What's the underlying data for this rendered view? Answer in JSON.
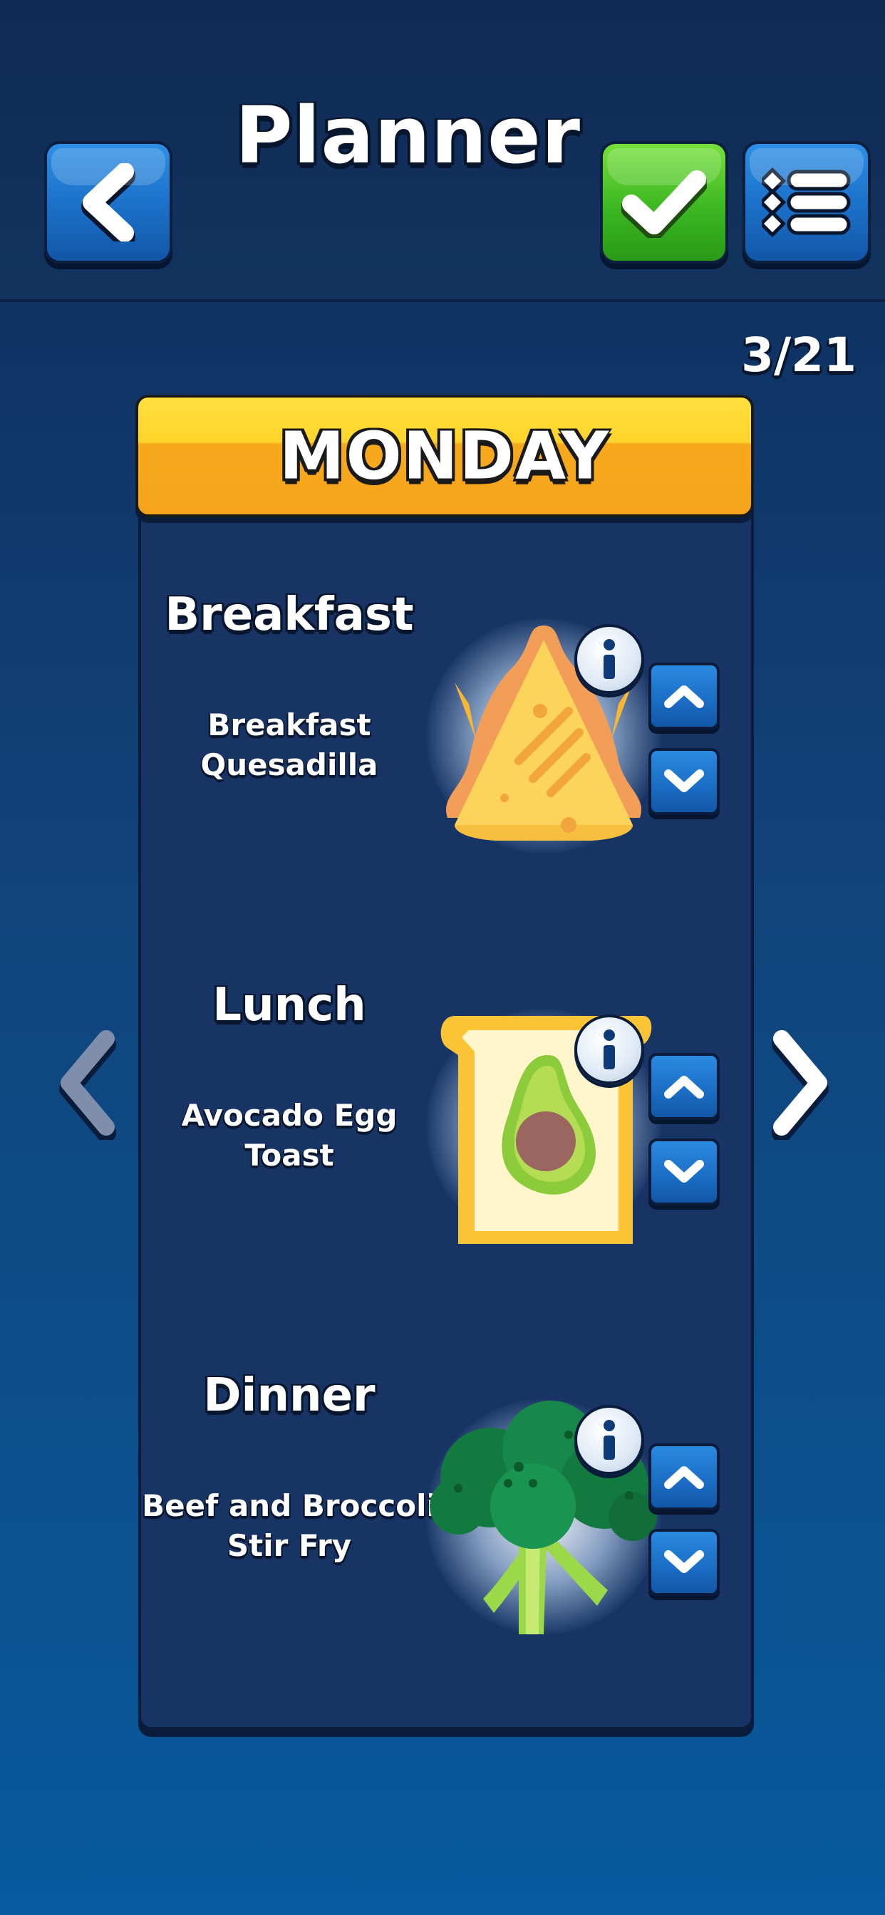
{
  "header": {
    "title": "Planner",
    "back_icon": "chevron-left-icon",
    "confirm_icon": "checkmark-icon",
    "menu_icon": "list-icon"
  },
  "progress": {
    "counter_text": "3/21",
    "current": 3,
    "total": 21
  },
  "day": {
    "label": "MONDAY"
  },
  "meals": [
    {
      "title": "Breakfast",
      "name_lines": [
        "Breakfast",
        "Quesadilla"
      ],
      "icon": "quesadilla-icon"
    },
    {
      "title": "Lunch",
      "name_lines": [
        "Avocado Egg Toast"
      ],
      "icon": "avocado-toast-icon"
    },
    {
      "title": "Dinner",
      "name_lines": [
        "Beef and Broccoli",
        "Stir Fry"
      ],
      "icon": "broccoli-icon"
    }
  ],
  "navigation": {
    "prev_icon": "chevron-left-icon",
    "next_icon": "chevron-right-icon",
    "prev_enabled": false,
    "next_enabled": true
  },
  "colors": {
    "accent_blue": "#1b6fc7",
    "confirm_green": "#3cb722",
    "day_header_yellow": "#ffd42b",
    "panel_bg": "#173465"
  }
}
